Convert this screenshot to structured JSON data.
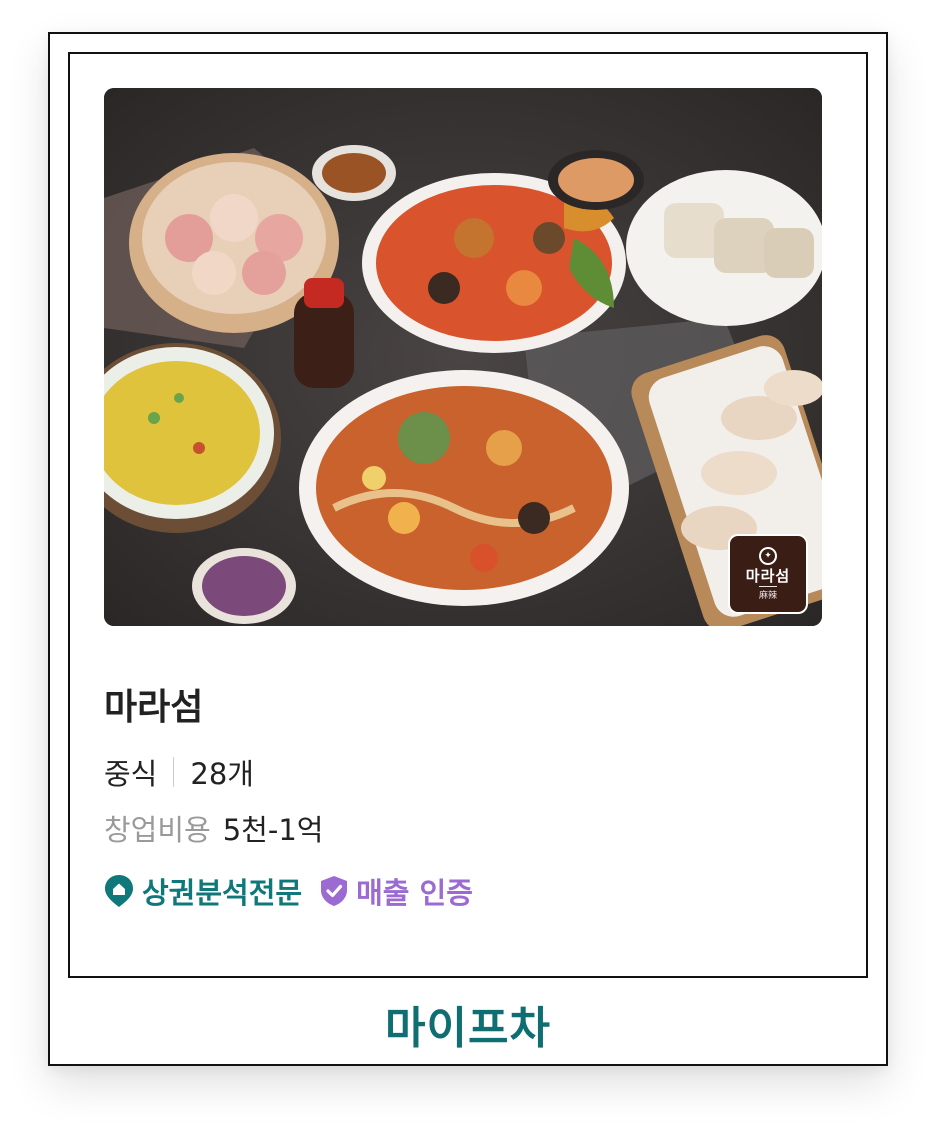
{
  "card": {
    "title": "마라섬",
    "category": "중식",
    "store_count": "28개",
    "cost_label": "창업비용",
    "cost_value": "5천-1억",
    "tags": [
      {
        "label": "상권분석전문",
        "icon": "location-pin-icon",
        "color": "#10777a"
      },
      {
        "label": "매출 인증",
        "icon": "shield-check-icon",
        "color": "#9b6ad3"
      }
    ]
  },
  "badge": {
    "name": "마라섬",
    "sub": "麻辣"
  },
  "footer": {
    "logo": "마이프차"
  },
  "colors": {
    "accent_teal": "#0f6e71",
    "accent_purple": "#9b6ad3",
    "badge_brown": "#3a1d14"
  }
}
